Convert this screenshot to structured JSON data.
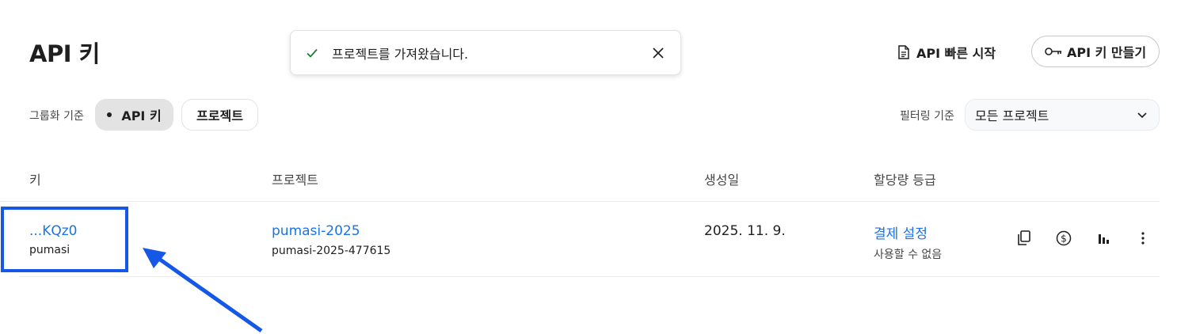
{
  "page": {
    "title": "API 키"
  },
  "toast": {
    "message": "프로젝트를 가져왔습니다."
  },
  "header": {
    "quickstart_label": "API 빠른 시작",
    "create_label": "API 키 만들기"
  },
  "grouping": {
    "label": "그룹화 기준",
    "options": [
      "API 키",
      "프로젝트"
    ],
    "selected": "API 키"
  },
  "filter": {
    "label": "필터링 기준",
    "selected": "모든 프로젝트"
  },
  "table": {
    "columns": [
      "키",
      "프로젝트",
      "생성일",
      "할당량 등급"
    ],
    "rows": [
      {
        "key": "...KQz0",
        "key_name": "pumasi",
        "project": "pumasi-2025",
        "project_id": "pumasi-2025-477615",
        "created": "2025. 11. 9.",
        "quota_link": "결제 설정",
        "quota_status": "사용할 수 없음"
      }
    ]
  },
  "colors": {
    "accent": "#1a73e8",
    "highlight": "#1557e6",
    "success": "#188038"
  }
}
